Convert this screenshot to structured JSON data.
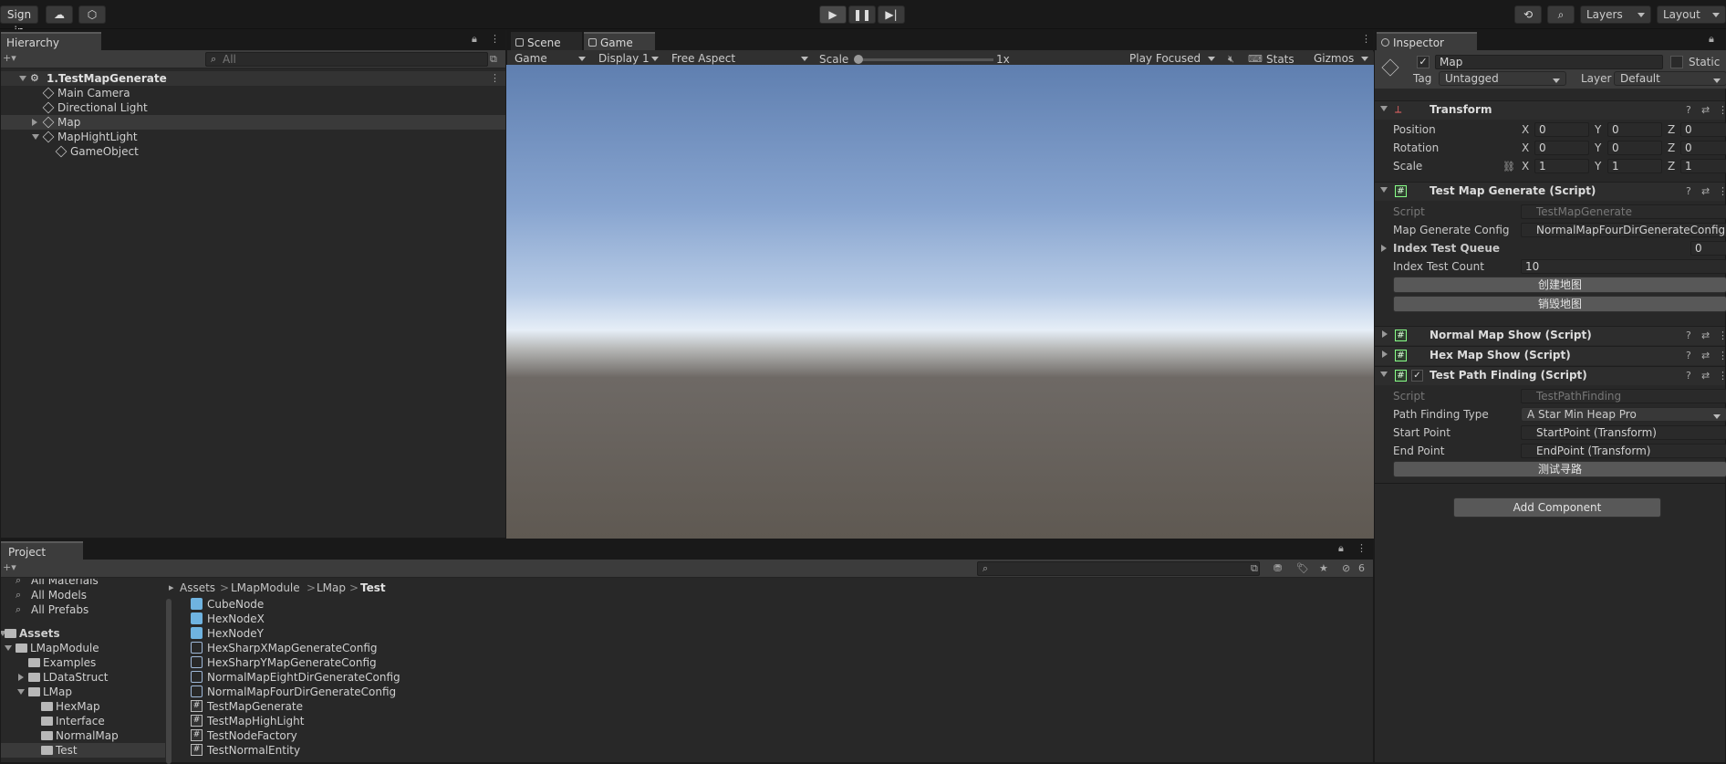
{
  "toolbar": {
    "sign_in": "Sign in",
    "layers": "Layers",
    "layout": "Layout"
  },
  "hierarchy": {
    "tab": "Hierarchy",
    "search_placeholder": "All",
    "scene": "1.TestMapGenerate",
    "items": [
      {
        "label": "Main Camera"
      },
      {
        "label": "Directional Light"
      },
      {
        "label": "Map"
      },
      {
        "label": "MapHightLight"
      },
      {
        "label": "GameObject"
      }
    ]
  },
  "game_view": {
    "tab_scene": "Scene",
    "tab_game": "Game",
    "mode": "Game",
    "display": "Display 1",
    "aspect": "Free Aspect",
    "scale_label": "Scale",
    "scale_value": "1x",
    "play_focus": "Play Focused",
    "stats": "Stats",
    "gizmos": "Gizmos"
  },
  "inspector": {
    "tab": "Inspector",
    "object_name": "Map",
    "static_label": "Static",
    "tag_label": "Tag",
    "tag_value": "Untagged",
    "layer_label": "Layer",
    "layer_value": "Default",
    "transform": {
      "title": "Transform",
      "position_label": "Position",
      "rotation_label": "Rotation",
      "scale_label": "Scale",
      "position": {
        "x": "0",
        "y": "0",
        "z": "0"
      },
      "rotation": {
        "x": "0",
        "y": "0",
        "z": "0"
      },
      "scale": {
        "x": "1",
        "y": "1",
        "z": "1"
      }
    },
    "test_map_generate": {
      "title": "Test Map Generate (Script)",
      "script_label": "Script",
      "script_value": "TestMapGenerate",
      "config_label": "Map Generate Config",
      "config_value": "NormalMapFourDirGenerateConfig",
      "queue_label": "Index Test Queue",
      "queue_value": "0",
      "count_label": "Index Test Count",
      "count_value": "10",
      "create_button": "创建地图",
      "destroy_button": "销毁地图"
    },
    "normal_map_show": {
      "title": "Normal Map Show (Script)"
    },
    "hex_map_show": {
      "title": "Hex Map Show (Script)"
    },
    "test_path_finding": {
      "title": "Test Path Finding (Script)",
      "script_label": "Script",
      "script_value": "TestPathFinding",
      "type_label": "Path Finding Type",
      "type_value": "A Star Min Heap Pro",
      "start_label": "Start Point",
      "start_value": "StartPoint (Transform)",
      "end_label": "End Point",
      "end_value": "EndPoint (Transform)",
      "test_button": "测试寻路"
    },
    "add_component": "Add Component"
  },
  "project": {
    "tab": "Project",
    "hidden_count": "6",
    "favorites": [
      {
        "label": "All Materials"
      },
      {
        "label": "All Models"
      },
      {
        "label": "All Prefabs"
      }
    ],
    "tree": [
      {
        "label": "Assets"
      },
      {
        "label": "LMapModule"
      },
      {
        "label": "Examples"
      },
      {
        "label": "LDataStruct"
      },
      {
        "label": "LMap"
      },
      {
        "label": "HexMap"
      },
      {
        "label": "Interface"
      },
      {
        "label": "NormalMap"
      },
      {
        "label": "Test"
      }
    ],
    "breadcrumb": [
      "Assets",
      "LMapModule",
      "LMap",
      "Test"
    ],
    "assets": [
      {
        "label": "CubeNode",
        "icon": "prefab-icon"
      },
      {
        "label": "HexNodeX",
        "icon": "prefab-icon"
      },
      {
        "label": "HexNodeY",
        "icon": "prefab-icon"
      },
      {
        "label": "HexSharpXMapGenerateConfig",
        "icon": "config-icon"
      },
      {
        "label": "HexSharpYMapGenerateConfig",
        "icon": "config-icon"
      },
      {
        "label": "NormalMapEightDirGenerateConfig",
        "icon": "config-icon"
      },
      {
        "label": "NormalMapFourDirGenerateConfig",
        "icon": "config-icon"
      },
      {
        "label": "TestMapGenerate",
        "icon": "script-icon"
      },
      {
        "label": "TestMapHighLight",
        "icon": "script-icon"
      },
      {
        "label": "TestNodeFactory",
        "icon": "script-icon"
      },
      {
        "label": "TestNormalEntity",
        "icon": "script-icon"
      }
    ]
  }
}
